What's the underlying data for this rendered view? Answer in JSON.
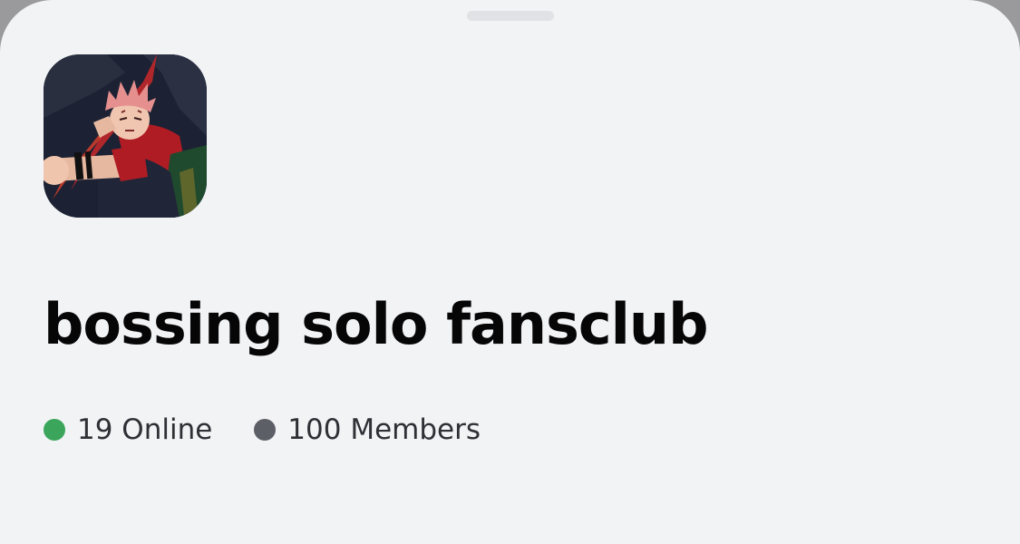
{
  "server": {
    "name": "bossing solo fansclub",
    "icon": "anime-character-server-icon"
  },
  "stats": {
    "online_label": "19 Online",
    "members_label": "100 Members"
  },
  "colors": {
    "sheet_background": "#f2f3f5",
    "online_dot": "#3ba55c",
    "members_dot": "#5d5f66",
    "title_text": "#060607",
    "stat_text": "#2e3035"
  }
}
